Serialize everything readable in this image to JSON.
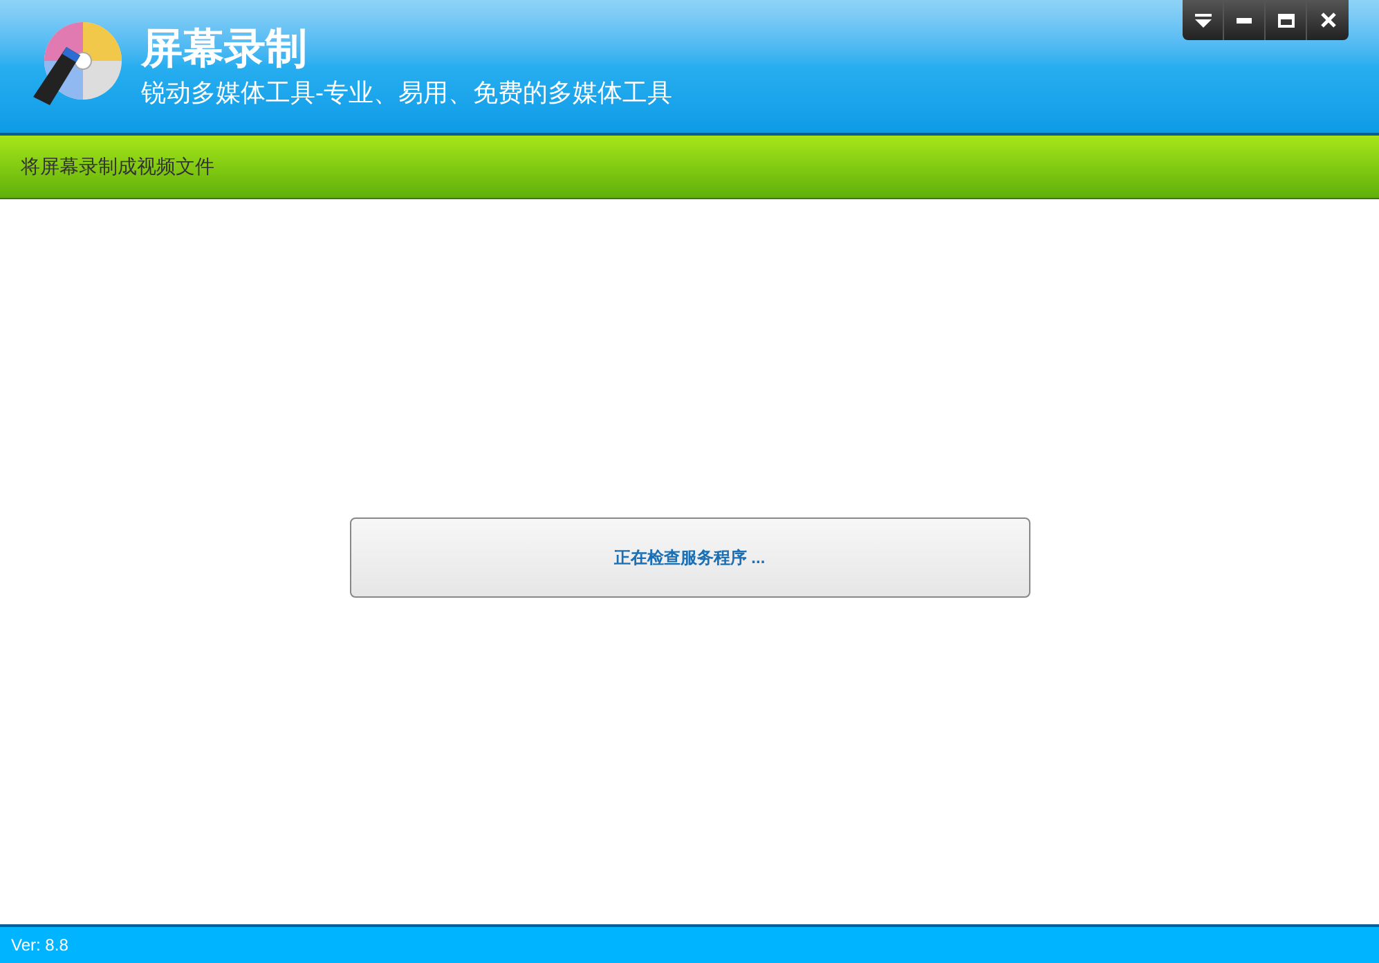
{
  "header": {
    "title": "屏幕录制",
    "subtitle": "锐动多媒体工具-专业、易用、免费的多媒体工具"
  },
  "window_controls": [
    {
      "kind": "menu"
    },
    {
      "kind": "minimize"
    },
    {
      "kind": "maximize"
    },
    {
      "kind": "close"
    }
  ],
  "toolbar": {
    "label": "将屏幕录制成视频文件"
  },
  "status_message": "正在检查服务程序 ...",
  "status_bar": {
    "version": "Ver: 8.8"
  }
}
